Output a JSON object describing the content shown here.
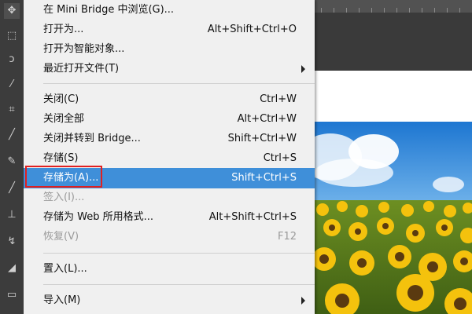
{
  "menu": {
    "items": [
      {
        "label": "在 Mini Bridge 中浏览(G)...",
        "shortcut": ""
      },
      {
        "label": "打开为...",
        "shortcut": "Alt+Shift+Ctrl+O"
      },
      {
        "label": "打开为智能对象...",
        "shortcut": ""
      },
      {
        "label": "最近打开文件(T)",
        "shortcut": ""
      },
      {
        "label": "关闭(C)",
        "shortcut": "Ctrl+W"
      },
      {
        "label": "关闭全部",
        "shortcut": "Alt+Ctrl+W"
      },
      {
        "label": "关闭并转到 Bridge...",
        "shortcut": "Shift+Ctrl+W"
      },
      {
        "label": "存储(S)",
        "shortcut": "Ctrl+S"
      },
      {
        "label": "存储为(A)...",
        "shortcut": "Shift+Ctrl+S"
      },
      {
        "label": "签入(I)...",
        "shortcut": ""
      },
      {
        "label": "存储为 Web 所用格式...",
        "shortcut": "Alt+Shift+Ctrl+S"
      },
      {
        "label": "恢复(V)",
        "shortcut": "F12"
      },
      {
        "label": "置入(L)...",
        "shortcut": ""
      },
      {
        "label": "导入(M)",
        "shortcut": ""
      }
    ]
  },
  "colors": {
    "menu_bg": "#f0f0f0",
    "selected_bg": "#3f8fd9",
    "highlight_box": "#e02020",
    "toolbar_bg": "#3c3c3c"
  },
  "icons": [
    "move-tool-icon",
    "marquee-tool-icon",
    "lasso-tool-icon",
    "magic-wand-tool-icon",
    "crop-tool-icon",
    "eyedropper-tool-icon",
    "healing-brush-tool-icon",
    "brush-tool-icon",
    "clone-stamp-tool-icon",
    "history-brush-tool-icon",
    "eraser-tool-icon",
    "gradient-tool-icon"
  ]
}
